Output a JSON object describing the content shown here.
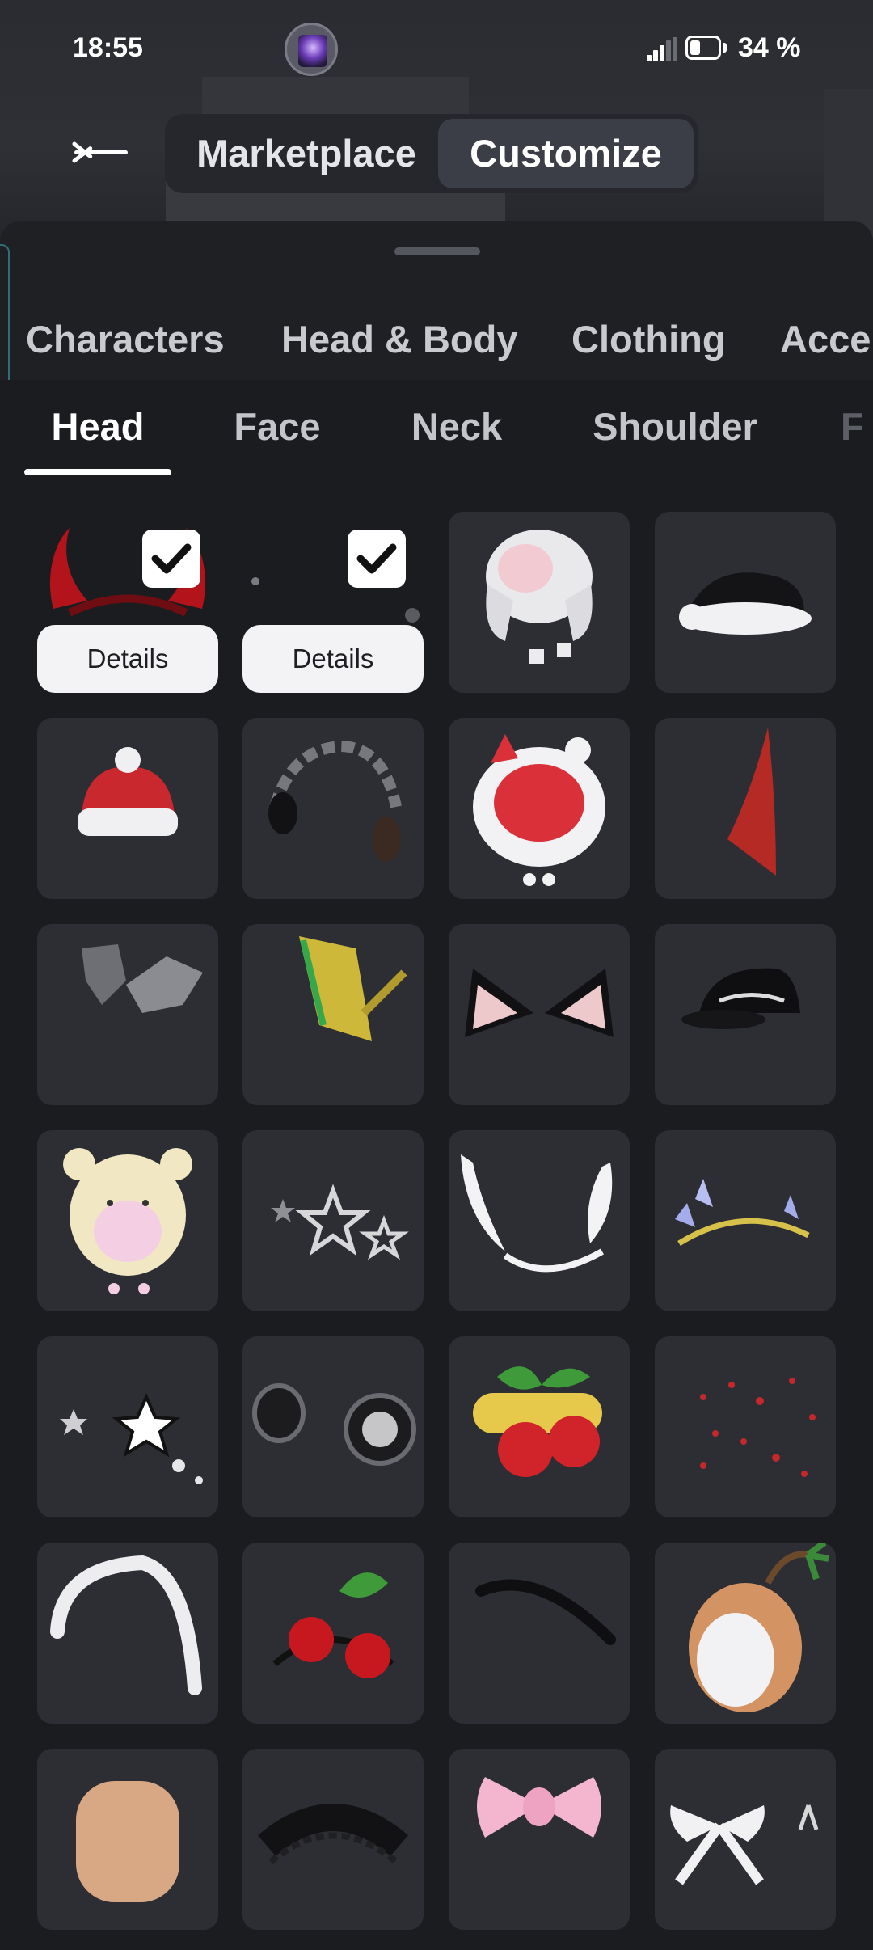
{
  "status_bar": {
    "time": "18:55",
    "battery_percent": "34 %"
  },
  "header": {
    "segment_options": [
      {
        "label": "Marketplace",
        "selected": false
      },
      {
        "label": "Customize",
        "selected": true
      }
    ]
  },
  "categories": [
    "Characters",
    "Head & Body",
    "Clothing",
    "Acce"
  ],
  "subtabs": [
    {
      "label": "Head",
      "active": true
    },
    {
      "label": "Face",
      "active": false
    },
    {
      "label": "Neck",
      "active": false
    },
    {
      "label": "Shoulder",
      "active": false
    },
    {
      "label": "F",
      "active": false
    }
  ],
  "grid": {
    "details_label": "Details",
    "items": [
      {
        "name": "devil-horns",
        "equipped": true
      },
      {
        "name": "dark-horns",
        "equipped": true
      },
      {
        "name": "trapper-hat",
        "equipped": false
      },
      {
        "name": "santa-hat-black",
        "equipped": false
      },
      {
        "name": "red-beanie",
        "equipped": false
      },
      {
        "name": "chain-headphones",
        "equipped": false
      },
      {
        "name": "bunny-strawberry-hood",
        "equipped": false
      },
      {
        "name": "red-horn",
        "equipped": false
      },
      {
        "name": "robot-ear-armor",
        "equipped": false
      },
      {
        "name": "yellow-guitar-accessory",
        "equipped": false
      },
      {
        "name": "cat-ears-black",
        "equipped": false
      },
      {
        "name": "black-cap",
        "equipped": false
      },
      {
        "name": "bear-hood",
        "equipped": false
      },
      {
        "name": "star-clips",
        "equipped": false
      },
      {
        "name": "angel-wings-headband",
        "equipped": false
      },
      {
        "name": "crystal-vine-tiara",
        "equipped": false
      },
      {
        "name": "white-star-clips",
        "equipped": false
      },
      {
        "name": "fluffy-earmuffs",
        "equipped": false
      },
      {
        "name": "cherry-clip",
        "equipped": false
      },
      {
        "name": "scattered-cherries",
        "equipped": false
      },
      {
        "name": "white-headband",
        "equipped": false
      },
      {
        "name": "cherry-headband",
        "equipped": false
      },
      {
        "name": "black-headband",
        "equipped": false
      },
      {
        "name": "coconut-palm-hat",
        "equipped": false
      },
      {
        "name": "skin-head",
        "equipped": false
      },
      {
        "name": "black-lace-headband",
        "equipped": false
      },
      {
        "name": "pink-bow",
        "equipped": false
      },
      {
        "name": "white-ribbon-bows",
        "equipped": false
      }
    ]
  }
}
